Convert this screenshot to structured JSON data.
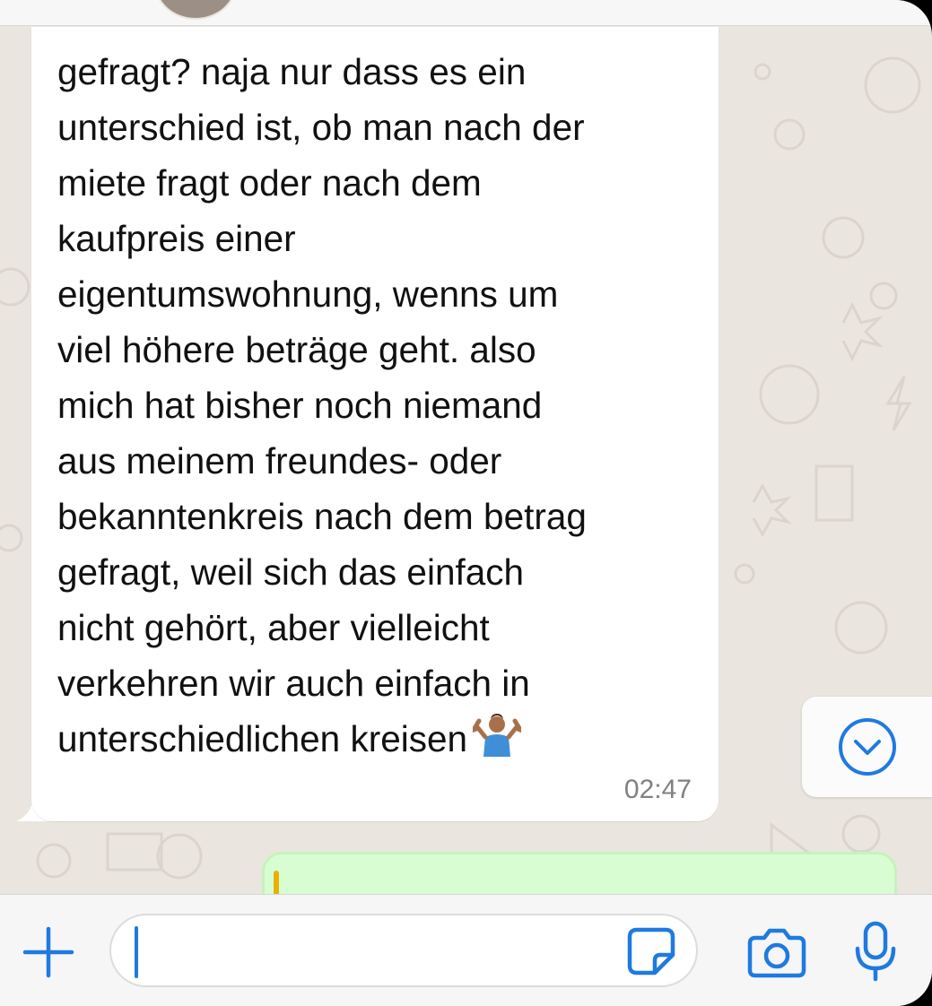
{
  "colors": {
    "accent": "#1f7ae0",
    "chat_background": "#eae6df",
    "incoming_bubble": "#ffffff",
    "outgoing_bubble": "#d9fdd3",
    "quote_bar": "#e7b100"
  },
  "message": {
    "text": "gefragt? naja nur dass es ein\nunterschied ist, ob man nach der\nmiete fragt oder nach dem\nkaufpreis einer\neigentumswohnung, wenns um\nviel höhere beträge geht. also\nmich hat bisher noch niemand\naus meinem freundes- oder\nbekanntenkreis nach dem betrag\ngefragt, weil sich das einfach\nnicht gehört, aber vielleicht\nverkehren wir auch einfach in\nunterschiedlichen kreisen",
    "emoji": "person-shrugging",
    "time": "02:47"
  },
  "composer": {
    "value": "",
    "icons": [
      "plus-icon",
      "sticker-icon",
      "camera-icon",
      "microphone-icon"
    ]
  },
  "scroll_button": {
    "icon": "chevron-down-icon"
  }
}
